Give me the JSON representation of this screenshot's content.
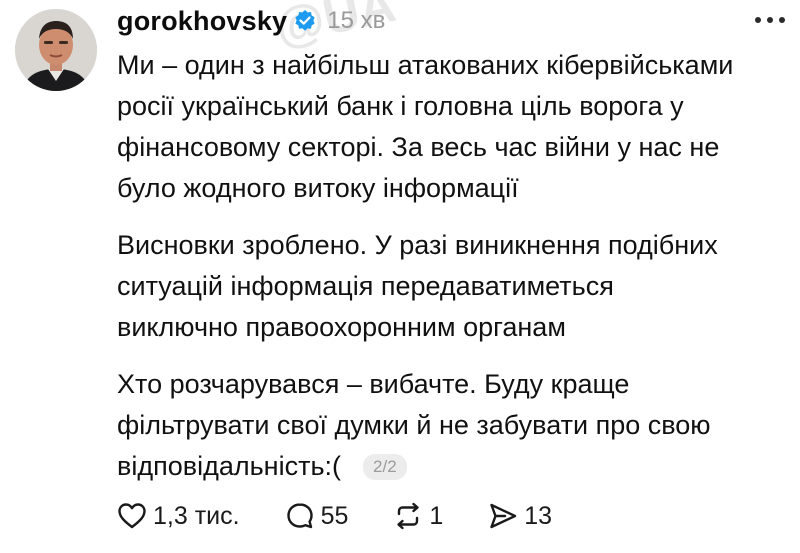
{
  "post": {
    "username": "gorokhovsky",
    "timestamp": "15 хв",
    "verified_icon": "verified-badge-icon",
    "accent_color": "#1d9bf0",
    "paragraphs": [
      [
        "Ми – один з найбільш атакованих кібервійськами",
        "росії український банк і головна ціль ворога у",
        "фінансовому секторі. За весь час війни у нас не",
        "було жодного витоку інформації"
      ],
      [
        "Висновки зроблено. У разі виникнення подібних",
        "ситуацій інформація передаватиметься",
        "виключно правоохоронним органам"
      ],
      [
        "Хто розчарувався – вибачте. Буду краще",
        "фільтрувати свої думки й не забувати про свою",
        "відповідальність:("
      ]
    ],
    "page_indicator": "2/2"
  },
  "actions": {
    "like": {
      "icon": "heart-icon",
      "count": "1,3 тис."
    },
    "reply": {
      "icon": "comment-icon",
      "count": "55"
    },
    "repost": {
      "icon": "repost-icon",
      "count": "1"
    },
    "share": {
      "icon": "send-icon",
      "count": "13"
    }
  },
  "watermark": "@UA"
}
